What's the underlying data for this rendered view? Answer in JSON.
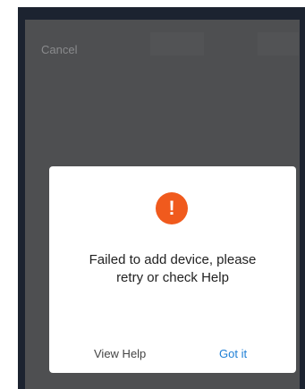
{
  "top_bar": {
    "cancel_label": "Cancel"
  },
  "dialog": {
    "icon": "exclamation-icon",
    "icon_glyph": "!",
    "icon_color": "#f05a1d",
    "message_line1": "Failed to add device, please",
    "message_line2": "retry or check Help",
    "view_help_label": "View Help",
    "got_it_label": "Got it",
    "primary_color": "#1e7fd6"
  }
}
